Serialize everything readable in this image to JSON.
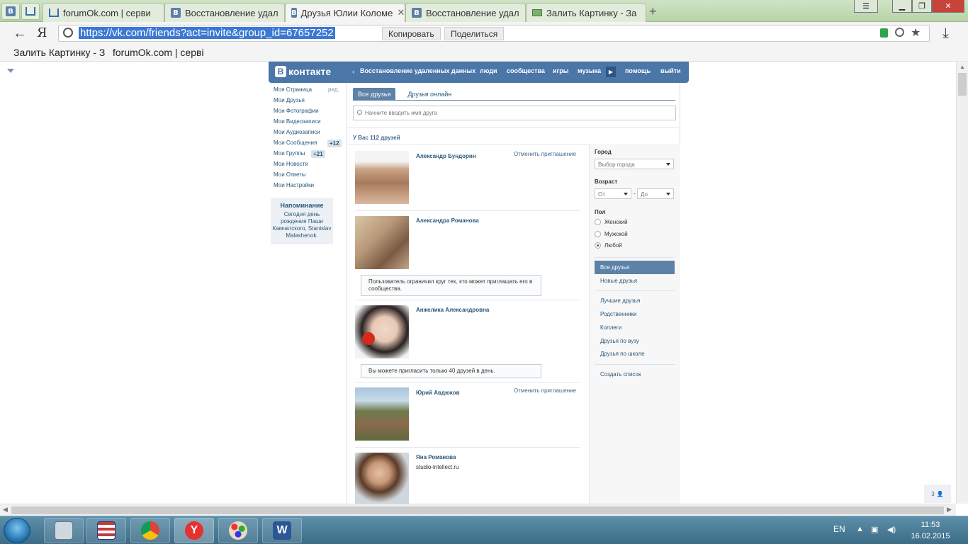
{
  "browser": {
    "tabs": [
      {
        "title": "forumOk.com | серви"
      },
      {
        "title": "Восстановление удал"
      },
      {
        "title": "Друзья Юлии Коломе"
      },
      {
        "title": "Восстановление удал"
      },
      {
        "title": "Залить Картинку - За"
      }
    ],
    "active_tab_close": "✕",
    "new_tab": "+",
    "url": "https://vk.com/friends?act=invite&group_id=67657252",
    "copy_button": "Копировать",
    "share_button": "Поделиться",
    "bookmarks": [
      "Залить Картинку - З",
      "forumOk.com | серві"
    ]
  },
  "vk": {
    "logo": "контакте",
    "logo_letter": "В",
    "nav": {
      "back_link": "Восстановление удаленных данных",
      "items": [
        "люди",
        "сообщества",
        "игры",
        "музыка",
        "помощь",
        "выйти"
      ]
    },
    "left_menu": {
      "items": [
        "Моя Страница",
        "Мои Друзья",
        "Мои Фотографии",
        "Мои Видеозаписи",
        "Мои Аудиозаписи",
        "Мои Сообщения",
        "Мои Группы",
        "Мои Новости",
        "Мои Ответы",
        "Мои Настройки"
      ],
      "edit_link": "ред.",
      "messages_badge": "+12",
      "groups_badge": "+21"
    },
    "reminder": {
      "title": "Напоминание",
      "text": "Сегодня день рождения Паши Камчатского, Stanislav Malashenok."
    },
    "tabs": {
      "all": "Все друзья",
      "online": "Друзья онлайн"
    },
    "search_placeholder": "Начните вводить имя друга",
    "friends_count": "У Вас 112 друзей",
    "friends": [
      {
        "name": "Александр Бундорин",
        "action": "Отменить приглашение"
      },
      {
        "name": "Александра Романова",
        "notice": "Пользователь ограничил круг тех, кто может приглашать его в сообщества."
      },
      {
        "name": "Анжелика Александровна",
        "notice": "Вы можете пригласить только 40 друзей в день."
      },
      {
        "name": "Юрий Авдюков",
        "action": "Отменить приглашение"
      },
      {
        "name": "Яна Романова",
        "sub": "studio-intellect.ru"
      }
    ],
    "filters": {
      "city_label": "Город",
      "city_select": "Выбор города",
      "age_label": "Возраст",
      "age_from": "От",
      "age_dash": "-",
      "age_to": "До",
      "sex_label": "Пол",
      "sex_options": [
        "Женский",
        "Мужской",
        "Любой"
      ],
      "lists_active": "Все друзья",
      "lists": [
        "Новые друзья",
        "Лучшие друзья",
        "Родственники",
        "Коллеги",
        "Друзья по вузу",
        "Друзья по школе"
      ],
      "create_list": "Создать список"
    },
    "float_counter": "3"
  },
  "taskbar": {
    "lang": "EN",
    "time": "11:53",
    "date": "16.02.2015"
  }
}
